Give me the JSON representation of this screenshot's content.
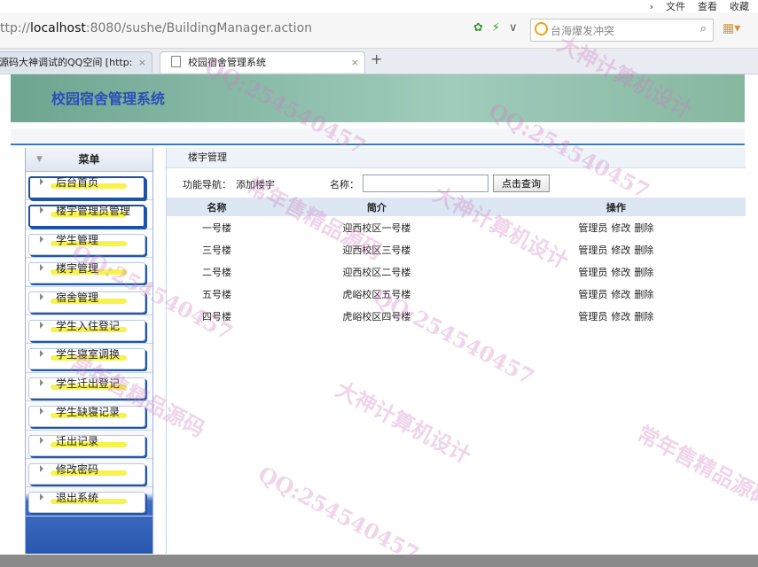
{
  "browser": {
    "top_menu": [
      "文件",
      "查看",
      "收藏"
    ],
    "url_prefix": "ttp://",
    "url_host": "localhost",
    "url_rest": ":8080/sushe/BuildingManager.action",
    "search_text": "台海爆发冲突",
    "tabs": [
      {
        "title": "源码大神调试的QQ空间 [http:",
        "close": "×"
      },
      {
        "title": "校园宿舍管理系统",
        "close": "×"
      }
    ],
    "new_tab": "+"
  },
  "banner": {
    "title": "校园宿舍管理系统"
  },
  "sidebar": {
    "heading": "菜单",
    "items": [
      {
        "label": "后台首页"
      },
      {
        "label": "楼宇管理员管理"
      },
      {
        "label": "学生管理"
      },
      {
        "label": "楼宇管理"
      },
      {
        "label": "宿舍管理"
      },
      {
        "label": "学生入住登记"
      },
      {
        "label": "学生寝室调换"
      },
      {
        "label": "学生迁出登记"
      },
      {
        "label": "学生缺寝记录"
      },
      {
        "label": "迁出记录"
      },
      {
        "label": "修改密码"
      },
      {
        "label": "退出系统"
      }
    ]
  },
  "main": {
    "breadcrumb": "楼宇管理",
    "nav_label": "功能导航：",
    "nav_link": "添加楼宇",
    "name_label": "名称：",
    "query_button": "点击查询",
    "columns": [
      "名称",
      "简介",
      "操作"
    ],
    "rows": [
      {
        "name": "一号楼",
        "intro": "迎西校区一号楼"
      },
      {
        "name": "三号楼",
        "intro": "迎西校区三号楼"
      },
      {
        "name": "二号楼",
        "intro": "迎西校区二号楼"
      },
      {
        "name": "五号楼",
        "intro": "虎峪校区五号楼"
      },
      {
        "name": "四号楼",
        "intro": "虎峪校区四号楼"
      }
    ],
    "actions": [
      "管理员",
      "修改",
      "删除"
    ]
  },
  "watermarks": [
    "QQ:254540457",
    "大神计算机设计",
    "常年售精品源码"
  ]
}
